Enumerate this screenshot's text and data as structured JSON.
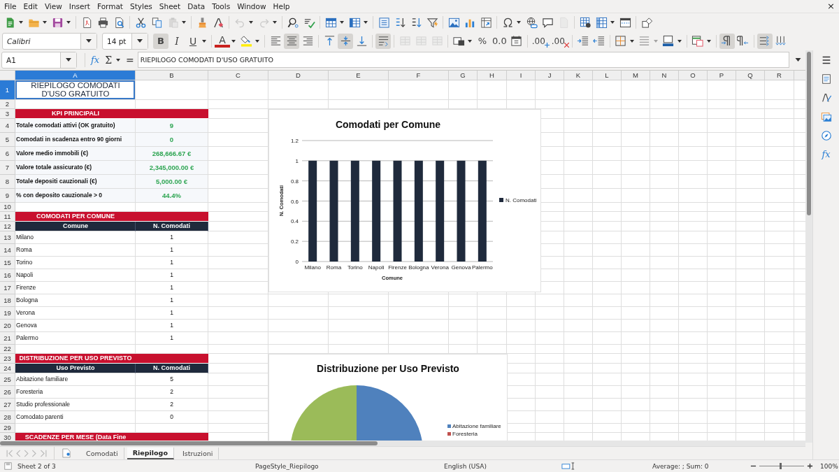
{
  "menu": [
    "File",
    "Edit",
    "View",
    "Insert",
    "Format",
    "Styles",
    "Sheet",
    "Data",
    "Tools",
    "Window",
    "Help"
  ],
  "close_glyph": "×",
  "standard_toolbar": {
    "paste": {
      "disabled": true
    },
    "undo": {
      "disabled": true
    },
    "redo": {
      "disabled": true
    },
    "header_footer": {
      "disabled": true
    }
  },
  "format_toolbar": {
    "font_name": "Calibri",
    "font_size": "14 pt",
    "bold": {
      "glyph": "B",
      "on": true
    },
    "italic": {
      "glyph": "I",
      "on": false
    },
    "underline": {
      "glyph": "U",
      "on": false
    },
    "font_color": {
      "glyph": "A"
    },
    "align_left": {
      "on": false
    },
    "align_center": {
      "on": true
    },
    "align_right": {
      "on": false
    },
    "align_top": {
      "on": false
    },
    "align_middle": {
      "on": true
    },
    "align_bottom": {
      "on": false
    },
    "wrap_text": {
      "on": true
    },
    "merge_center": {
      "disabled": true
    },
    "merge": {
      "disabled": true
    },
    "unmerge": {
      "disabled": true
    },
    "percent": {
      "glyph": "%"
    },
    "decimal": {
      "glyph": "0.0"
    },
    "add_decimal": {
      "glyph": ".00"
    },
    "delete_decimal": {
      "glyph": ".00"
    },
    "border_style": {
      "disabled": true
    },
    "left_to_right": {
      "on": true
    },
    "right_to_left": {
      "on": false
    },
    "horizontal_text": {
      "on": true
    },
    "vertical_text": {
      "on": false
    }
  },
  "formula_bar": {
    "name_box": "A1",
    "function_glyph": "fx",
    "sum_glyph": "Σ",
    "equals_glyph": "=",
    "content": "RIEPILOGO COMODATI D'USO GRATUITO"
  },
  "sidebar": {
    "functions_glyph": "fx"
  },
  "sheet": {
    "columns": [
      {
        "label": "A",
        "selected": true
      },
      {
        "label": "B",
        "selected": false
      },
      {
        "label": "C",
        "selected": false
      },
      {
        "label": "D",
        "selected": false
      },
      {
        "label": "E",
        "selected": false
      },
      {
        "label": "F",
        "selected": false
      },
      {
        "label": "G",
        "selected": false
      },
      {
        "label": "H",
        "selected": false
      },
      {
        "label": "I",
        "selected": false
      },
      {
        "label": "J",
        "selected": false
      },
      {
        "label": "K",
        "selected": false
      },
      {
        "label": "L",
        "selected": false
      },
      {
        "label": "M",
        "selected": false
      },
      {
        "label": "N",
        "selected": false
      },
      {
        "label": "O",
        "selected": false
      },
      {
        "label": "P",
        "selected": false
      },
      {
        "label": "Q",
        "selected": false
      },
      {
        "label": "R",
        "selected": false
      }
    ],
    "rows": [
      {
        "num": "1",
        "kind": "title",
        "selected": true,
        "a": "RIEPILOGO COMODATI D'USO GRATUITO"
      },
      {
        "num": "2",
        "kind": "blank",
        "selected": false
      },
      {
        "num": "3",
        "kind": "section",
        "selected": false,
        "a": "KPI PRINCIPALI"
      },
      {
        "num": "4",
        "kind": "kpi",
        "selected": false,
        "a": "Totale comodati attivi (OK gratuito)",
        "b": "9"
      },
      {
        "num": "5",
        "kind": "kpi",
        "selected": false,
        "a": "Comodati in scadenza entro 90 giorni",
        "b": "0"
      },
      {
        "num": "6",
        "kind": "kpi",
        "selected": false,
        "a": "Valore medio immobili (€)",
        "b": "268,666.67 €"
      },
      {
        "num": "7",
        "kind": "kpi",
        "selected": false,
        "a": "Valore totale assicurato (€)",
        "b": "2,345,000.00 €"
      },
      {
        "num": "8",
        "kind": "kpi",
        "selected": false,
        "a": "Totale depositi cauzionali (€)",
        "b": "5,000.00 €"
      },
      {
        "num": "9",
        "kind": "kpi",
        "selected": false,
        "a": "% con deposito cauzionale > 0",
        "b": "44.4%"
      },
      {
        "num": "10",
        "kind": "blank",
        "selected": false
      },
      {
        "num": "11",
        "kind": "section",
        "selected": false,
        "a": "COMODATI PER COMUNE"
      },
      {
        "num": "12",
        "kind": "header",
        "selected": false,
        "a": "Comune",
        "b": "N. Comodati"
      },
      {
        "num": "13",
        "kind": "data",
        "selected": false,
        "a": "Milano",
        "b": "1"
      },
      {
        "num": "14",
        "kind": "data",
        "selected": false,
        "a": "Roma",
        "b": "1"
      },
      {
        "num": "15",
        "kind": "data",
        "selected": false,
        "a": "Torino",
        "b": "1"
      },
      {
        "num": "16",
        "kind": "data",
        "selected": false,
        "a": "Napoli",
        "b": "1"
      },
      {
        "num": "17",
        "kind": "data",
        "selected": false,
        "a": "Firenze",
        "b": "1"
      },
      {
        "num": "18",
        "kind": "data",
        "selected": false,
        "a": "Bologna",
        "b": "1"
      },
      {
        "num": "19",
        "kind": "data",
        "selected": false,
        "a": "Verona",
        "b": "1"
      },
      {
        "num": "20",
        "kind": "data",
        "selected": false,
        "a": "Genova",
        "b": "1"
      },
      {
        "num": "21",
        "kind": "data",
        "selected": false,
        "a": "Palermo",
        "b": "1"
      },
      {
        "num": "22",
        "kind": "blank",
        "selected": false
      },
      {
        "num": "23",
        "kind": "section",
        "selected": false,
        "a": "DISTRIBUZIONE PER USO PREVISTO"
      },
      {
        "num": "24",
        "kind": "header",
        "selected": false,
        "a": "Uso Previsto",
        "b": "N. Comodati"
      },
      {
        "num": "25",
        "kind": "data",
        "selected": false,
        "a": "Abitazione familiare",
        "b": "5"
      },
      {
        "num": "26",
        "kind": "data",
        "selected": false,
        "a": "Foresteria",
        "b": "2"
      },
      {
        "num": "27",
        "kind": "data",
        "selected": false,
        "a": "Studio professionale",
        "b": "2"
      },
      {
        "num": "28",
        "kind": "data",
        "selected": false,
        "a": "Comodato parenti",
        "b": "0"
      },
      {
        "num": "29",
        "kind": "blank",
        "selected": false
      },
      {
        "num": "30",
        "kind": "section",
        "selected": false,
        "a": "SCADENZE PER MESE (Data Fine"
      }
    ]
  },
  "bar_chart": {
    "chart_data": {
      "type": "bar",
      "title": "Comodati per Comune",
      "xlabel": "Comune",
      "ylabel": "N. Comodati",
      "categories": [
        "Milano",
        "Roma",
        "Torino",
        "Napoli",
        "Firenze",
        "Bologna",
        "Verona",
        "Genova",
        "Palermo"
      ],
      "series": [
        {
          "name": "N. Comodati",
          "color": "#1f2a3c",
          "values": [
            1,
            1,
            1,
            1,
            1,
            1,
            1,
            1,
            1
          ]
        }
      ],
      "ylim": [
        0,
        1.2
      ],
      "grid": true,
      "yticks": [
        0,
        0.2,
        0.4,
        0.6,
        0.8,
        1,
        1.2
      ]
    }
  },
  "pie_chart": {
    "title": "Distribuzione per Uso Previsto",
    "legend": [
      {
        "label": "Abitazione familiare",
        "color": "#4f81bd"
      },
      {
        "label": "Foresteria",
        "color": "#c0504d"
      }
    ]
  },
  "sheet_tabs": [
    {
      "label": "Comodati",
      "selected": false
    },
    {
      "label": "Riepilogo",
      "selected": true
    },
    {
      "label": "Istruzioni",
      "selected": false
    }
  ],
  "status_bar": {
    "sheet": "Sheet 2 of 3",
    "page_style": "PageStyle_Riepilogo",
    "language": "English (USA)",
    "summary": "Average: ; Sum: 0",
    "zoom": {
      "level": 0.47
    },
    "zoom_text": "100%"
  }
}
